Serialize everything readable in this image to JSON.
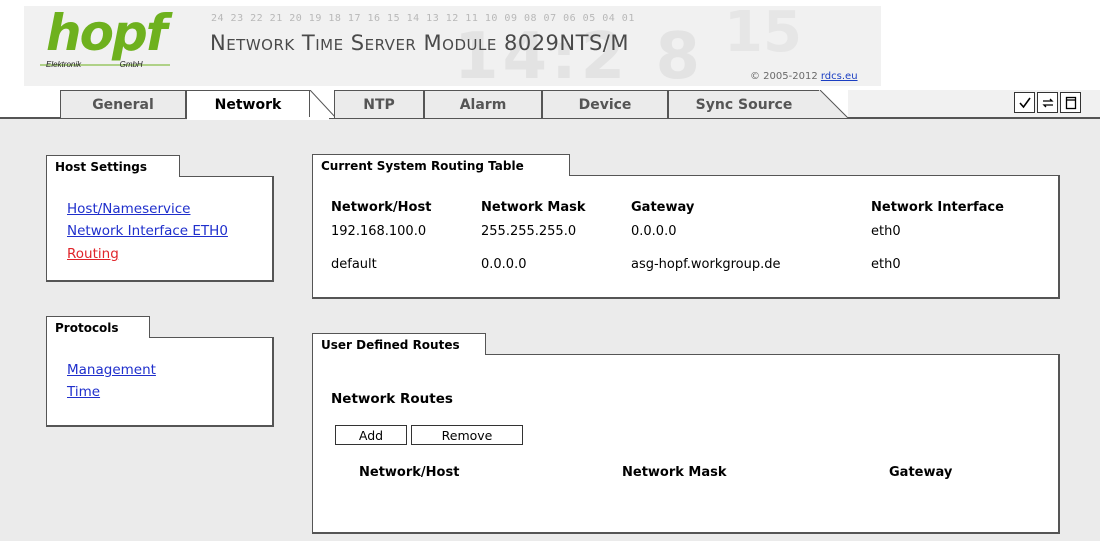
{
  "header": {
    "logo_word": "hopf",
    "logo_sub_left": "Elektronik",
    "logo_sub_right": "GmbH",
    "digit_scale": "24 23 22 21 20 19 18 17 16 15 14 13 12 11 10 09 08 07 06 05 04 01",
    "title": "Network Time Server Module 8029NTS/M",
    "copyright_prefix": "© 2005-2012 ",
    "copyright_link": "rdcs.eu"
  },
  "tabs": [
    {
      "label": "General"
    },
    {
      "label": "Network"
    },
    {
      "label": "NTP"
    },
    {
      "label": "Alarm"
    },
    {
      "label": "Device"
    },
    {
      "label": "Sync Source"
    }
  ],
  "active_tab": "Network",
  "toolbar_icons": [
    "checkmark-icon",
    "refresh-icon",
    "page-icon"
  ],
  "host_settings": {
    "title": "Host Settings",
    "links": [
      {
        "label": "Host/Nameservice"
      },
      {
        "label": "Network Interface ETH0"
      },
      {
        "label": "Routing"
      }
    ],
    "active_link": "Routing"
  },
  "protocols": {
    "title": "Protocols",
    "links": [
      {
        "label": "Management"
      },
      {
        "label": "Time"
      }
    ]
  },
  "routing_table": {
    "title": "Current System Routing Table",
    "columns": [
      "Network/Host",
      "Network Mask",
      "Gateway",
      "Network Interface"
    ],
    "rows": [
      [
        "192.168.100.0",
        "255.255.255.0",
        "0.0.0.0",
        "eth0"
      ],
      [
        "default",
        "0.0.0.0",
        "asg-hopf.workgroup.de",
        "eth0"
      ]
    ]
  },
  "user_routes": {
    "title": "User Defined Routes",
    "subtitle": "Network Routes",
    "add_label": "Add",
    "remove_label": "Remove",
    "columns": [
      "Network/Host",
      "Network Mask",
      "Gateway"
    ]
  },
  "colors": {
    "logo_green": "#6eb11e",
    "link_blue": "#1f2fcc",
    "link_active_red": "#e0242a",
    "content_bg": "#ebebeb"
  }
}
